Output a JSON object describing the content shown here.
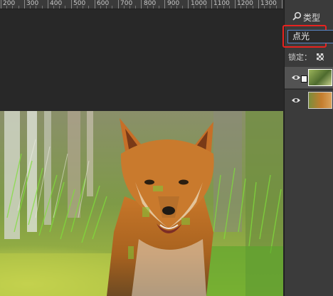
{
  "ruler": {
    "labels": [
      "200",
      "300",
      "400",
      "500",
      "600",
      "700",
      "800",
      "900",
      "1000",
      "1100",
      "1200",
      "1300"
    ]
  },
  "layers_panel": {
    "filter_icon": "search-icon",
    "filter_label": "类型",
    "blend_mode": "点光",
    "lock_label": "锁定：",
    "lock_icon": "checker-lock-icon",
    "layers": [
      {
        "visible_icon": "eye-icon",
        "selected": true,
        "has_smart_filter_badge": true
      },
      {
        "visible_icon": "eye-icon",
        "selected": false,
        "has_smart_filter_badge": false
      }
    ]
  },
  "canvas": {
    "subject": "fox-photo",
    "highlight_color": "#e8231f",
    "accent_color": "#5a86c6"
  }
}
